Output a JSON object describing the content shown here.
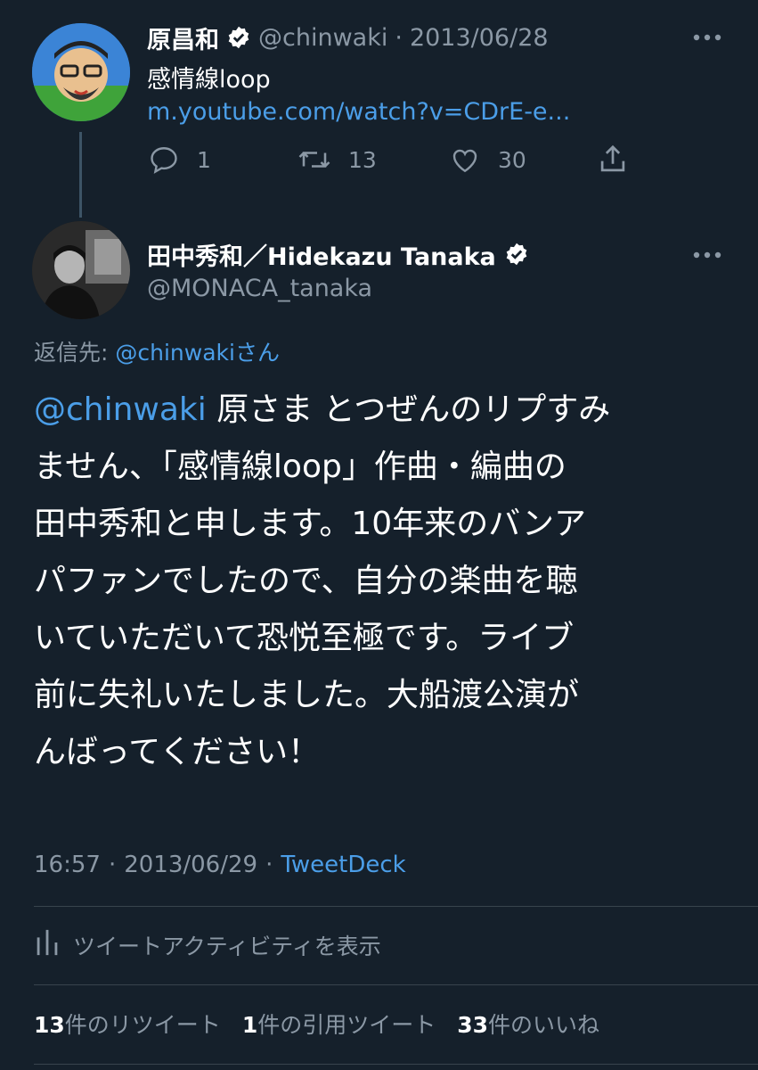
{
  "parent_tweet": {
    "display_name": "原昌和",
    "handle": "@chinwaki",
    "separator": "·",
    "date": "2013/06/28",
    "text": "感情線loop",
    "link": "m.youtube.com/watch?v=CDrE-e...",
    "actions": {
      "reply_count": "1",
      "retweet_count": "13",
      "like_count": "30"
    }
  },
  "main_tweet": {
    "display_name": "田中秀和／Hidekazu Tanaka",
    "handle": "@MONACA_tanaka",
    "reply_to_label": "返信先:",
    "reply_to_handle": "@chinwakiさん",
    "mention": "@chinwaki",
    "lines": [
      " 原さま とつぜんのリプすみ",
      "ません、「感情線loop」作曲・編曲の",
      "田中秀和と申します。10年来のバンア",
      "パファンでしたので、自分の楽曲を聴",
      "いていただいて恐悦至極です。ライブ",
      "前に失礼いたしました。大船渡公演が",
      "んばってください！"
    ],
    "time": "16:57",
    "separator1": "·",
    "date": "2013/06/29",
    "separator2": "·",
    "client": "TweetDeck"
  },
  "activity_label": "ツイートアクティビティを表示",
  "stats": {
    "retweets_count": "13",
    "retweets_label": "件のリツイート",
    "quotes_count": "1",
    "quotes_label": "件の引用ツイート",
    "likes_count": "33",
    "likes_label": "件のいいね"
  },
  "colors": {
    "background": "#15202b",
    "link": "#4b9ee8",
    "muted": "#8b98a5"
  }
}
